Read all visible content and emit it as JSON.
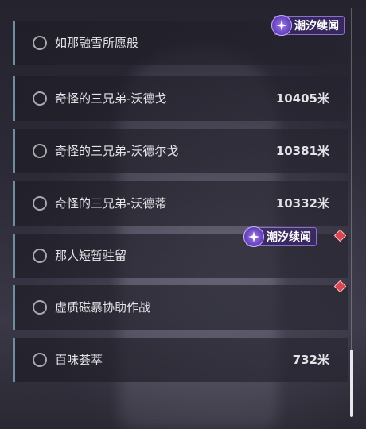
{
  "tasks": [
    {
      "label": "如那融雪所愿般",
      "distance": ""
    },
    {
      "label": "奇怪的三兄弟-沃德戈",
      "distance": "10405米"
    },
    {
      "label": "奇怪的三兄弟-沃德尔戈",
      "distance": "10381米"
    },
    {
      "label": "奇怪的三兄弟-沃德蒂",
      "distance": "10332米"
    },
    {
      "label": "那人短暂驻留",
      "distance": ""
    },
    {
      "label": "虚质磁暴协助作战",
      "distance": ""
    },
    {
      "label": "百味荟萃",
      "distance": "732米"
    }
  ],
  "badges": [
    {
      "text": "潮汐续闻"
    },
    {
      "text": "潮汐续闻"
    }
  ],
  "icons": {
    "radio": "radio-circle-icon",
    "badge": "tide-sparkle-icon",
    "marker": "red-diamond-marker-icon"
  },
  "colors": {
    "accent_bar": "#6f8d9f",
    "badge_purple": "#6a45c0",
    "marker_red": "#d9464f"
  }
}
